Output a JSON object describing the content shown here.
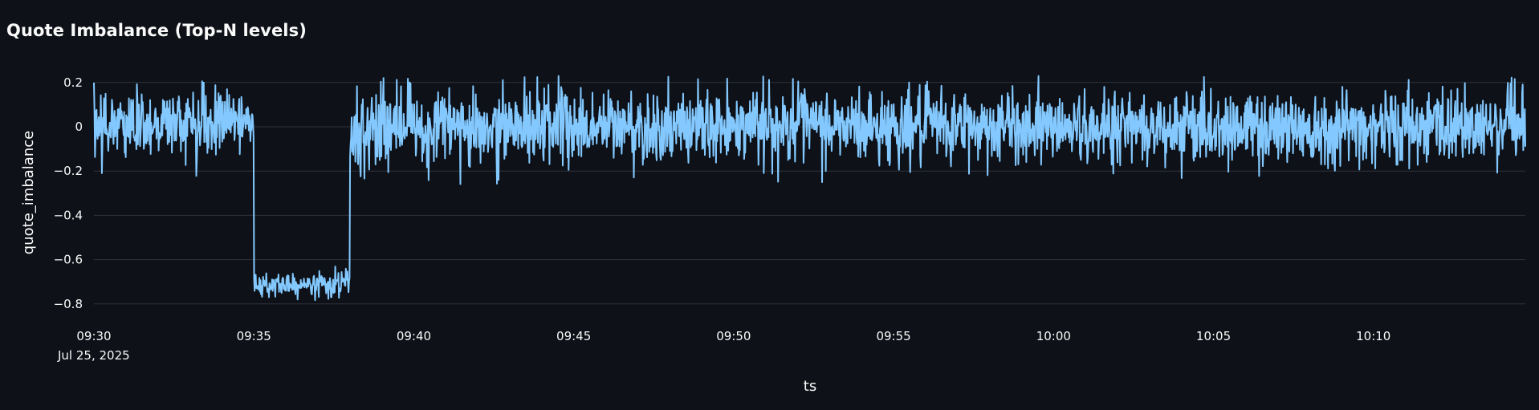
{
  "chart_data": {
    "type": "line",
    "title": "Quote Imbalance (Top-N levels)",
    "xlabel": "ts",
    "ylabel": "quote_imbalance",
    "date_label": "Jul 25, 2025",
    "x_start": "09:30",
    "x_end": "10:14:45",
    "x_ticks": [
      "09:30",
      "09:35",
      "09:40",
      "09:45",
      "09:50",
      "09:55",
      "10:00",
      "10:05",
      "10:10"
    ],
    "y_ticks": [
      0.2,
      0,
      -0.2,
      -0.4,
      -0.6,
      -0.8
    ],
    "y_tick_labels": [
      "0.2",
      "0",
      "−0.2",
      "−0.4",
      "−0.6",
      "−0.8"
    ],
    "ylim": [
      -0.85,
      0.25
    ],
    "grid": true,
    "series": [
      {
        "values_description": "",
        "regimes": [
          {
            "from": "09:30",
            "to": "09:35",
            "mean": 0.02,
            "range": [
              -0.24,
              0.21
            ]
          },
          {
            "from": "09:35",
            "to": "09:38",
            "mean": -0.71,
            "range": [
              -0.79,
              -0.62
            ]
          },
          {
            "from": "09:38",
            "to": "10:14:45",
            "mean": 0.0,
            "range": [
              -0.27,
              0.23
            ]
          }
        ]
      }
    ],
    "line_color": "#83c9ff"
  }
}
